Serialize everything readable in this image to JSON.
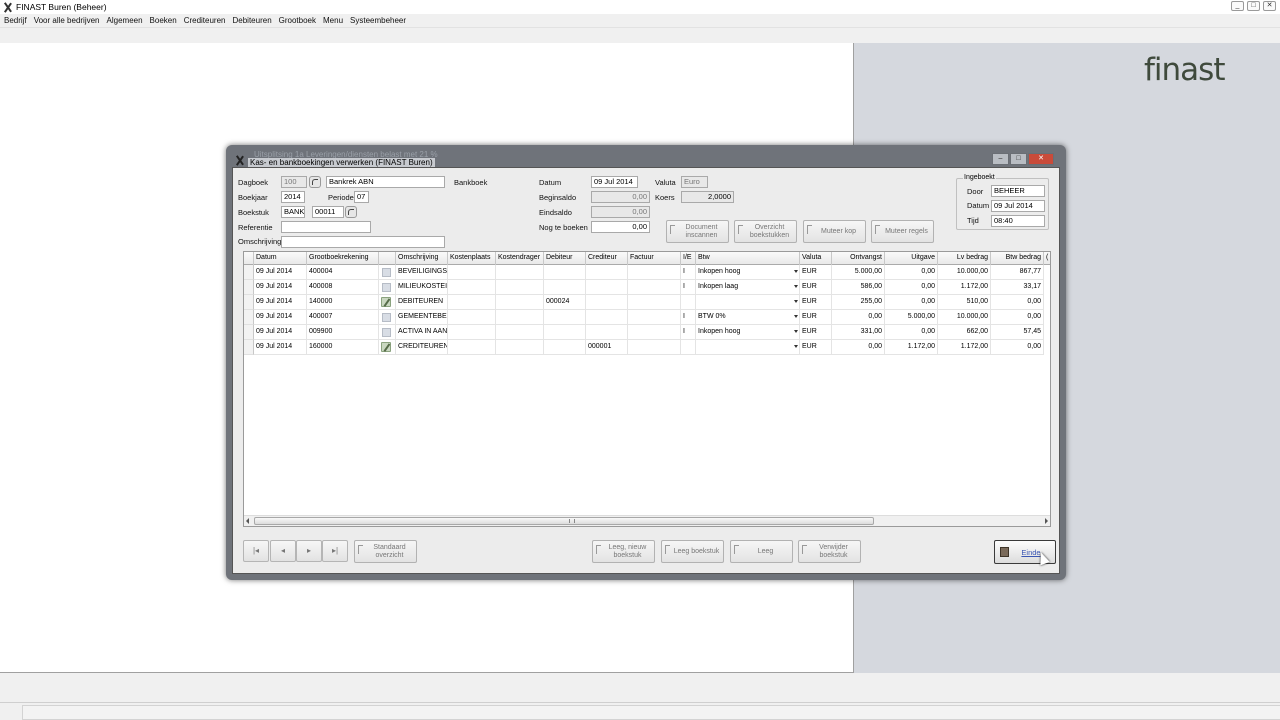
{
  "app": {
    "title": "FINAST Buren (Beheer)",
    "window_controls": [
      "_",
      "□",
      "✕"
    ]
  },
  "menu": [
    "Bedrijf",
    "Voor alle bedrijven",
    "Algemeen",
    "Boeken",
    "Crediteuren",
    "Debiteuren",
    "Grootboek",
    "Menu",
    "Systeembeheer"
  ],
  "logo": "finast",
  "child_window": {
    "ghost_title": "Uitsplitsing 1a Leveringen/diensten belast met 21 %",
    "title": "Kas- en bankboekingen verwerken  (FINAST Buren)",
    "controls": [
      "–",
      "□",
      "✕"
    ]
  },
  "form": {
    "dagboek": {
      "label": "Dagboek",
      "code": "100",
      "name": "Bankrek ABN",
      "type": "Bankboek"
    },
    "boekjaar": {
      "label": "Boekjaar",
      "value": "2014"
    },
    "periode": {
      "label": "Periode",
      "value": "07"
    },
    "boekstuk": {
      "label": "Boekstuk",
      "prefix": "BANK",
      "value": "00011"
    },
    "referentie": {
      "label": "Referentie",
      "value": ""
    },
    "omschrijving": {
      "label": "Omschrijving",
      "value": ""
    },
    "datum": {
      "label": "Datum",
      "value": "09 Jul 2014"
    },
    "valuta": {
      "label": "Valuta",
      "value": "Euro"
    },
    "koers": {
      "label": "Koers",
      "value": "2,0000"
    },
    "beginsaldo": {
      "label": "Beginsaldo",
      "value": "0,00"
    },
    "eindsaldo": {
      "label": "Eindsaldo",
      "value": "0,00"
    },
    "nog_te_boeken": {
      "label": "Nog te boeken",
      "value": "0,00"
    }
  },
  "ingeboekt": {
    "title": "Ingeboekt",
    "door_label": "Door",
    "door": "BEHEER",
    "datum_label": "Datum",
    "datum": "09 Jul 2014",
    "tijd_label": "Tijd",
    "tijd": "08:40"
  },
  "top_buttons": {
    "document_inscannen": "Document inscannen",
    "overzicht_boekstukken": "Overzicht boekstukken",
    "muteer_kop": "Muteer kop",
    "muteer_regels": "Muteer regels"
  },
  "grid": {
    "columns": [
      "Datum",
      "Grootboekrekening",
      "",
      "Omschrijving",
      "Kostenplaats",
      "Kostendrager",
      "Debiteur",
      "Crediteur",
      "Factuur",
      "I/E",
      "Btw",
      "Valuta",
      "Ontvangst",
      "Uitgave",
      "Lv bedrag",
      "Btw bedrag",
      "("
    ],
    "rows": [
      {
        "datum": "09 Jul 2014",
        "gb": "400004",
        "icon": "note",
        "omschr": "BEVEILIGINGS",
        "kp": "",
        "kd": "",
        "deb": "",
        "cred": "",
        "fact": "",
        "ie": "I",
        "btw": "Inkopen hoog",
        "valuta": "EUR",
        "ontv": "5.000,00",
        "uitg": "0,00",
        "lv": "10.000,00",
        "btwb": "867,77"
      },
      {
        "datum": "09 Jul 2014",
        "gb": "400008",
        "icon": "note",
        "omschr": "MILIEUKOSTEI",
        "kp": "",
        "kd": "",
        "deb": "",
        "cred": "",
        "fact": "",
        "ie": "I",
        "btw": "Inkopen laag",
        "valuta": "EUR",
        "ontv": "586,00",
        "uitg": "0,00",
        "lv": "1.172,00",
        "btwb": "33,17"
      },
      {
        "datum": "09 Jul 2014",
        "gb": "140000",
        "icon": "pen",
        "omschr": "DEBITEUREN",
        "kp": "",
        "kd": "",
        "deb": "000024",
        "cred": "",
        "fact": "",
        "ie": "",
        "btw": "",
        "valuta": "EUR",
        "ontv": "255,00",
        "uitg": "0,00",
        "lv": "510,00",
        "btwb": "0,00"
      },
      {
        "datum": "09 Jul 2014",
        "gb": "400007",
        "icon": "note",
        "omschr": "GEMEENTEBE",
        "kp": "",
        "kd": "",
        "deb": "",
        "cred": "",
        "fact": "",
        "ie": "I",
        "btw": "BTW 0%",
        "valuta": "EUR",
        "ontv": "0,00",
        "uitg": "5.000,00",
        "lv": "10.000,00",
        "btwb": "0,00"
      },
      {
        "datum": "09 Jul 2014",
        "gb": "009900",
        "icon": "note",
        "omschr": "ACTIVA IN AAN",
        "kp": "",
        "kd": "",
        "deb": "",
        "cred": "",
        "fact": "",
        "ie": "I",
        "btw": "Inkopen hoog",
        "valuta": "EUR",
        "ontv": "331,00",
        "uitg": "0,00",
        "lv": "662,00",
        "btwb": "57,45"
      },
      {
        "datum": "09 Jul 2014",
        "gb": "160000",
        "icon": "pen",
        "omschr": "CREDITEUREN",
        "kp": "",
        "kd": "",
        "deb": "",
        "cred": "000001",
        "fact": "",
        "ie": "",
        "btw": "",
        "valuta": "EUR",
        "ontv": "0,00",
        "uitg": "1.172,00",
        "lv": "1.172,00",
        "btwb": "0,00"
      }
    ]
  },
  "bottom_buttons": {
    "nav": [
      "|◂",
      "◂",
      "▸",
      "▸|"
    ],
    "standaard_overzicht": "Standaard overzicht",
    "leeg_nieuw_boekstuk": "Leeg, nieuw boekstuk",
    "leeg_boekstuk": "Leeg boekstuk",
    "leeg": "Leeg",
    "verwijder_boekstuk": "Verwijder boekstuk",
    "einde": "Einde"
  }
}
